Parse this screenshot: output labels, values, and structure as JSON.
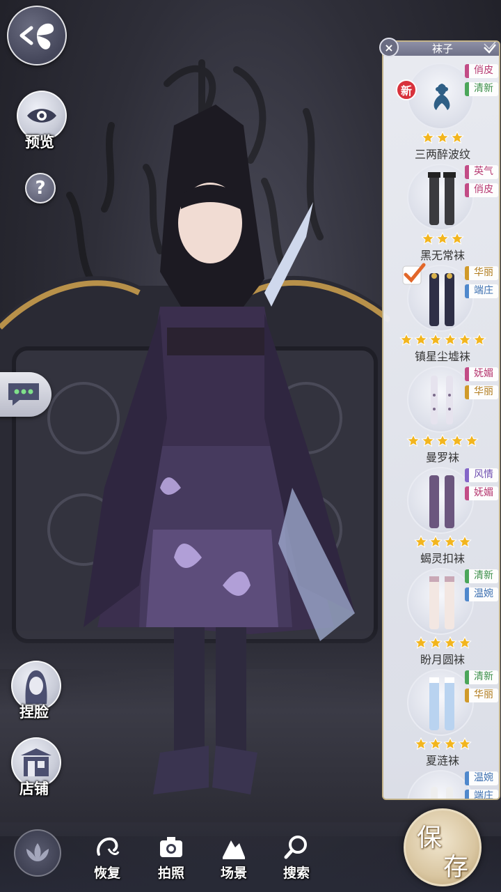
{
  "left_controls": {
    "back_icon": "butterfly-back-icon",
    "preview_label": "预览",
    "help_label": "?",
    "chat_icon": "chat-bubble-icon",
    "face_label": "捏脸",
    "shop_label": "店铺"
  },
  "panel": {
    "title": "袜子",
    "items": [
      {
        "name": "三两醉波纹",
        "tags": [
          "俏皮",
          "清新"
        ],
        "stars": 3,
        "is_new": true,
        "new_label": "新",
        "selected": false
      },
      {
        "name": "黑无常袜",
        "tags": [
          "英气",
          "俏皮"
        ],
        "stars": 3,
        "is_new": false,
        "selected": false
      },
      {
        "name": "镇星尘墟袜",
        "tags": [
          "华丽",
          "端庄"
        ],
        "stars": 6,
        "is_new": false,
        "selected": true
      },
      {
        "name": "曼罗袜",
        "tags": [
          "妩媚",
          "华丽"
        ],
        "stars": 5,
        "is_new": false,
        "selected": false
      },
      {
        "name": "蝎灵扣袜",
        "tags": [
          "风情",
          "妩媚"
        ],
        "stars": 4,
        "is_new": false,
        "selected": false
      },
      {
        "name": "盼月圆袜",
        "tags": [
          "清新",
          "温婉"
        ],
        "stars": 4,
        "is_new": false,
        "selected": false
      },
      {
        "name": "夏涟袜",
        "tags": [
          "清新",
          "华丽"
        ],
        "stars": 4,
        "is_new": false,
        "selected": false
      },
      {
        "name": "",
        "tags": [
          "温婉",
          "端庄"
        ],
        "stars": 0,
        "is_new": false,
        "selected": false
      }
    ]
  },
  "bottom_bar": {
    "lotus_icon": "lotus-icon",
    "tools": [
      {
        "label": "恢复",
        "icon": "restore-icon"
      },
      {
        "label": "拍照",
        "icon": "camera-icon"
      },
      {
        "label": "场景",
        "icon": "scene-icon"
      },
      {
        "label": "搜索",
        "icon": "search-icon"
      }
    ],
    "save_chars": [
      "保",
      "存"
    ]
  },
  "colors": {
    "tag_pink": "#b73b72",
    "tag_green": "#3c8f4a",
    "tag_gold": "#b07a1a",
    "star": "#f2b51e",
    "save_gold": "#d9c6a1"
  }
}
